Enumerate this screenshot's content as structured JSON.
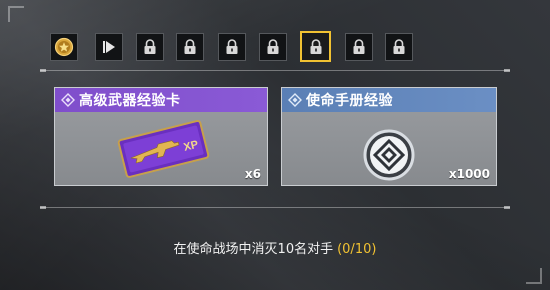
{
  "tiers": [
    {
      "icon": "star-medal-icon",
      "state": "unlocked"
    },
    {
      "icon": "play-icon",
      "state": "unlocked"
    },
    {
      "icon": "lock-icon",
      "state": "locked"
    },
    {
      "icon": "lock-icon",
      "state": "locked"
    },
    {
      "icon": "lock-icon",
      "state": "locked"
    },
    {
      "icon": "lock-icon",
      "state": "locked"
    },
    {
      "icon": "lock-icon",
      "state": "locked-selected"
    },
    {
      "icon": "lock-icon",
      "state": "locked"
    },
    {
      "icon": "lock-icon",
      "state": "locked"
    }
  ],
  "rewards": [
    {
      "title": "高级武器经验卡",
      "quantity": "x6",
      "rarity_color": "#8355cf",
      "item_icon": "weapon-xp-card-icon",
      "card_text": "XP"
    },
    {
      "title": "使命手册经验",
      "quantity": "x1000",
      "rarity_color": "#6088bf",
      "item_icon": "battle-pass-xp-emblem-icon"
    }
  ],
  "objective": {
    "text": "在使命战场中消灭10名对手",
    "progress": "(0/10)"
  },
  "colors": {
    "highlight": "#f1c232",
    "epic": "#8355cf",
    "rare": "#6088bf"
  }
}
